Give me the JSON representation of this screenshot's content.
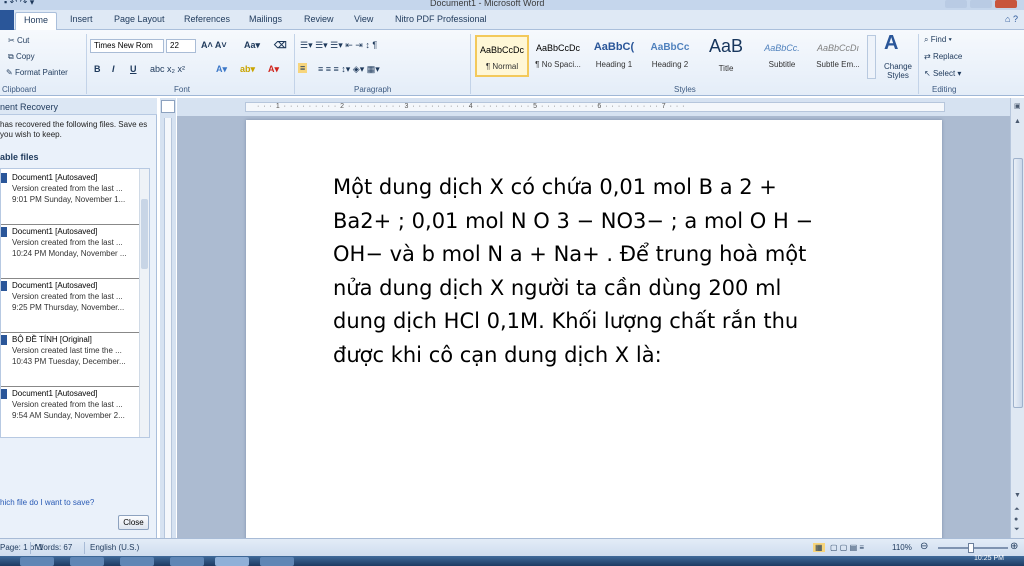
{
  "window": {
    "title": "Document1 - Microsoft Word"
  },
  "ribbon_tabs": [
    "Home",
    "Insert",
    "Page Layout",
    "References",
    "Mailings",
    "Review",
    "View",
    "Nitro PDF Professional"
  ],
  "clipboard": {
    "cut": "Cut",
    "copy": "Copy",
    "format_painter": "Format Painter",
    "label": "Clipboard"
  },
  "font": {
    "name": "Times New Rom",
    "size": "22",
    "label": "Font"
  },
  "paragraph": {
    "label": "Paragraph"
  },
  "styles": {
    "label": "Styles",
    "items": [
      {
        "sample": "AaBbCcDc",
        "name": "¶ Normal"
      },
      {
        "sample": "AaBbCcDc",
        "name": "¶ No Spaci..."
      },
      {
        "sample": "AaBbC(",
        "name": "Heading 1"
      },
      {
        "sample": "AaBbCc",
        "name": "Heading 2"
      },
      {
        "sample": "AaB",
        "name": "Title"
      },
      {
        "sample": "AaBbCc.",
        "name": "Subtitle"
      },
      {
        "sample": "AaBbCcDı",
        "name": "Subtle Em..."
      }
    ],
    "change_label": "Change Styles"
  },
  "editing": {
    "find": "Find",
    "replace": "Replace",
    "select": "Select",
    "label": "Editing"
  },
  "recovery_pane": {
    "title": "nent Recovery",
    "intro": "has recovered the following files.  Save es you wish to keep.",
    "subtitle": "able files",
    "files": [
      {
        "name": "Document1  [Autosaved]",
        "desc": "Version created from the last ...",
        "time": "9:01 PM Sunday, November 1..."
      },
      {
        "name": "Document1  [Autosaved]",
        "desc": "Version created from the last ...",
        "time": "10:24 PM Monday, November ..."
      },
      {
        "name": "Document1  [Autosaved]",
        "desc": "Version created from the last ...",
        "time": "9:25 PM Thursday, November..."
      },
      {
        "name": "BỘ ĐỀ TÍNH  [Original]",
        "desc": "Version created last time the ...",
        "time": "10:43 PM Tuesday, December..."
      },
      {
        "name": "Document1  [Autosaved]",
        "desc": "Version created from the last ...",
        "time": "9:54 AM Sunday, November 2..."
      }
    ],
    "help_link": "hich file do I want to save?",
    "close_label": "Close"
  },
  "document": {
    "lines": [
      "Một dung dịch X có chứa 0,01 mol B a 2 +",
      "Ba2+ ; 0,01 mol N O 3 − NO3− ; a mol O H −",
      "OH− và b mol N a + Na+ . Để trung hoà một",
      "nửa dung dịch X người ta cần dùng 200 ml",
      "dung dịch HCl 0,1M. Khối lượng chất rắn thu",
      "được khi cô cạn dung dịch X là:"
    ]
  },
  "status": {
    "page": "1 of 1",
    "words": "Words: 67",
    "language": "English (U.S.)",
    "zoom": "110%"
  },
  "taskbar": {
    "clock": "10:25 PM"
  }
}
